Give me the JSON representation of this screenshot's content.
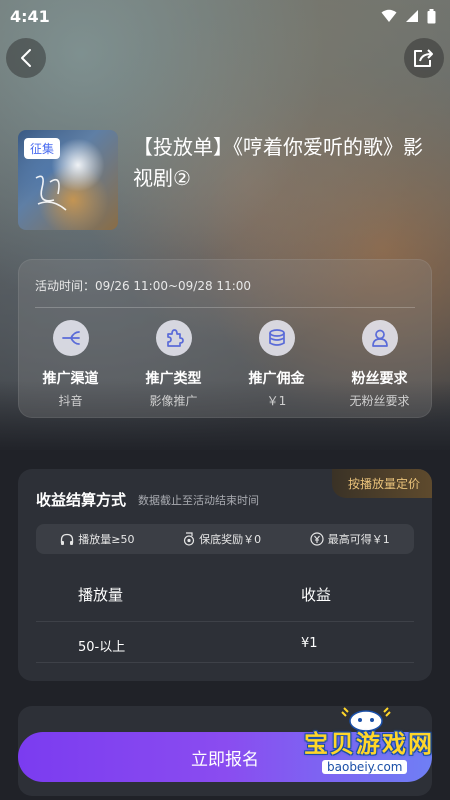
{
  "status_bar": {
    "time": "4:41"
  },
  "campaign": {
    "cover_tag": "征集",
    "title": "【投放单】《哼着你爱听的歌》影视剧②"
  },
  "info_card": {
    "activity_time": "活动时间：09/26 11:00~09/28 11:00",
    "items": [
      {
        "label": "推广渠道",
        "value": "抖音",
        "icon": "channel-icon"
      },
      {
        "label": "推广类型",
        "value": "影像推广",
        "icon": "puzzle-icon"
      },
      {
        "label": "推广佣金",
        "value": "￥1",
        "icon": "coins-icon"
      },
      {
        "label": "粉丝要求",
        "value": "无粉丝要求",
        "icon": "fan-icon"
      }
    ]
  },
  "settlement": {
    "badge": "按播放量定价",
    "title": "收益结算方式",
    "note": "数据截止至活动结束时间",
    "chips": [
      {
        "text": "播放量≥50",
        "icon": "headphones-icon"
      },
      {
        "text": "保底奖励￥0",
        "icon": "medal-icon"
      },
      {
        "text": "最高可得￥1",
        "icon": "yen-icon"
      }
    ],
    "table": {
      "headers": [
        "播放量",
        "收益"
      ],
      "rows": [
        [
          "50-以上",
          "¥1"
        ]
      ]
    }
  },
  "cta": {
    "label": "立即报名"
  },
  "watermark": {
    "text": "宝贝游戏网",
    "url": "baobeiy.com"
  },
  "colors": {
    "accent_start": "#7b3cf0",
    "accent_end": "#6f7ff4",
    "badge_gold": "#e9c27a"
  }
}
